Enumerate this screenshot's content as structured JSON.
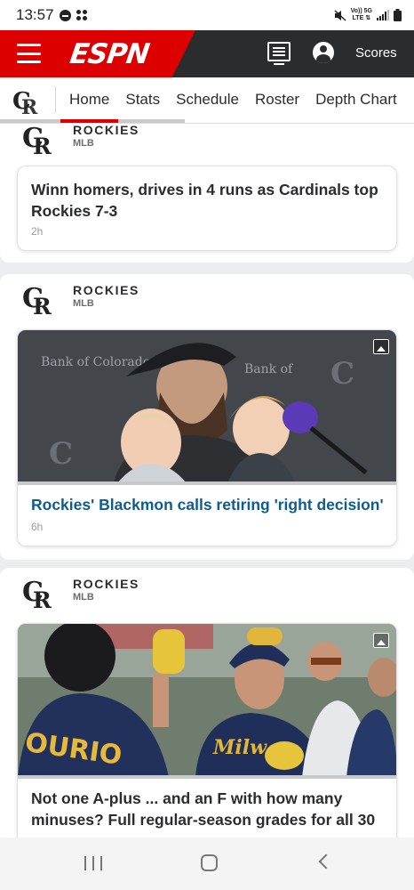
{
  "status_bar": {
    "time": "13:57",
    "network_top": "Vo)) 5G",
    "network_bottom": "LTE ⇅"
  },
  "header": {
    "logo_text": "ESPN",
    "scores_label": "Scores",
    "brand_color": "#dd0000"
  },
  "subnav": {
    "tabs": [
      "Home",
      "Stats",
      "Schedule",
      "Roster",
      "Depth Chart"
    ],
    "active_tab": "Home"
  },
  "feed": {
    "items": [
      {
        "team": "ROCKIES",
        "league": "MLB",
        "headline_line1": "Winn homers, drives in 4 runs as Cardinals top",
        "headline_line2": "Rockies 7-3",
        "age": "2h"
      },
      {
        "team": "ROCKIES",
        "league": "MLB",
        "headline": "Rockies' Blackmon calls retiring 'right decision'",
        "age": "6h",
        "image_text": "Bank of Colorado"
      },
      {
        "team": "ROCKIES",
        "league": "MLB",
        "headline_line1": "Not one A-plus ... and an F with how many",
        "headline_line2": "minuses? Full regular-season grades for all 30"
      }
    ]
  },
  "nav_bar": {
    "recents_icon": "recents-icon",
    "home_icon": "home-icon",
    "back_icon": "back-icon"
  }
}
